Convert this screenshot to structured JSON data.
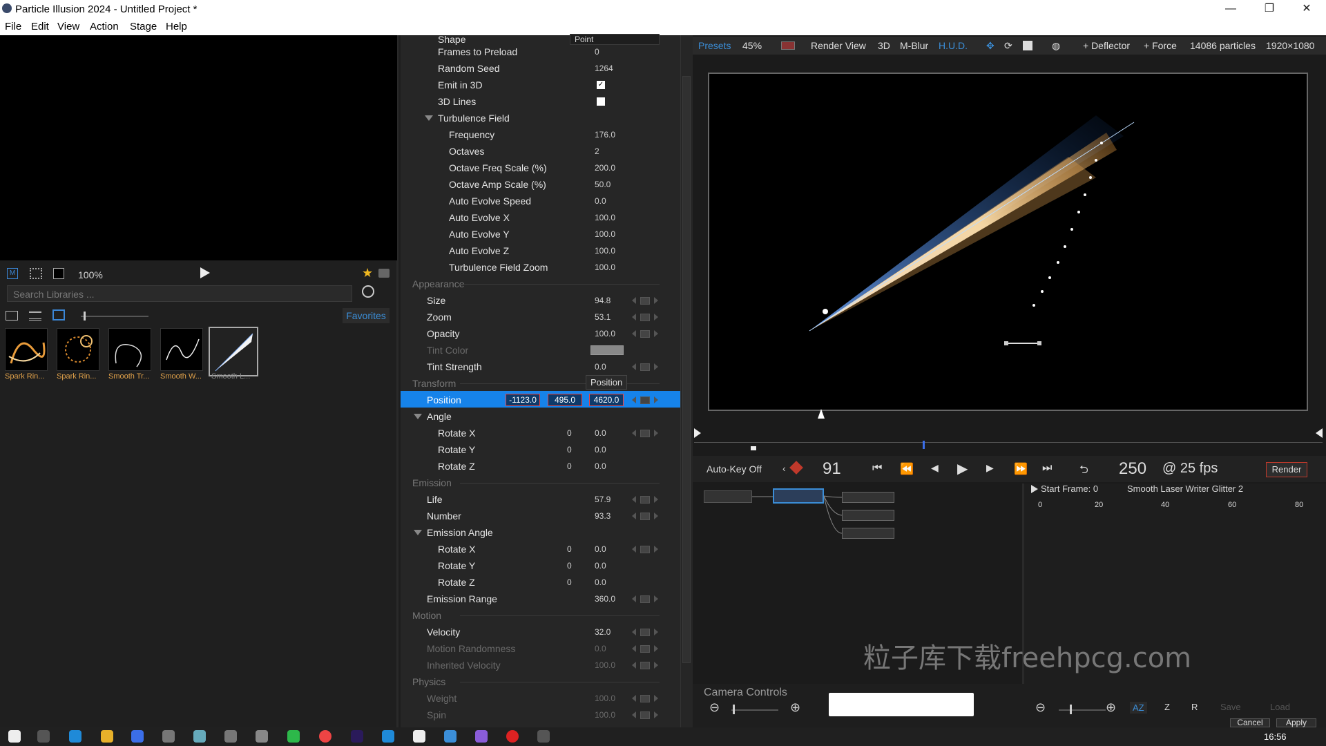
{
  "window": {
    "title": "Particle Illusion 2024 - Untitled Project *",
    "min": "—",
    "max": "❐",
    "close": "✕"
  },
  "menu": [
    "File",
    "Edit",
    "View",
    "Action",
    "Stage",
    "Help"
  ],
  "library": {
    "zoom": "100%",
    "search_placeholder": "Search Libraries ...",
    "favorites": "Favorites",
    "thumbs": [
      "Spark Rin...",
      "Spark Rin...",
      "Smooth Tr...",
      "Smooth W...",
      "Smooth L..."
    ]
  },
  "props": {
    "shape_label": "Shape",
    "shape_value": "Point",
    "rows": [
      {
        "label": "Frames to Preload",
        "value": "0"
      },
      {
        "label": "Random Seed",
        "value": "1264"
      },
      {
        "label": "Emit in 3D",
        "value": "✓"
      },
      {
        "label": "3D Lines",
        "value": ""
      },
      {
        "label": "Turbulence Field",
        "value": ""
      },
      {
        "label": "Frequency",
        "value": "176.0"
      },
      {
        "label": "Octaves",
        "value": "2"
      },
      {
        "label": "Octave Freq Scale (%)",
        "value": "200.0"
      },
      {
        "label": "Octave Amp Scale (%)",
        "value": "50.0"
      },
      {
        "label": "Auto Evolve Speed",
        "value": "0.0"
      },
      {
        "label": "Auto Evolve X",
        "value": "100.0"
      },
      {
        "label": "Auto Evolve Y",
        "value": "100.0"
      },
      {
        "label": "Auto Evolve Z",
        "value": "100.0"
      },
      {
        "label": "Turbulence Field Zoom",
        "value": "100.0"
      },
      {
        "label": "Appearance",
        "value": ""
      },
      {
        "label": "Size",
        "value": "94.8"
      },
      {
        "label": "Zoom",
        "value": "53.1"
      },
      {
        "label": "Opacity",
        "value": "100.0"
      },
      {
        "label": "Tint Color",
        "value": ""
      },
      {
        "label": "Tint Strength",
        "value": "0.0"
      },
      {
        "label": "Transform",
        "value": ""
      },
      {
        "label": "Position",
        "value": ""
      },
      {
        "label": "Angle",
        "value": ""
      },
      {
        "label": "Rotate X",
        "value": "0.0",
        "value2": "0"
      },
      {
        "label": "Rotate Y",
        "value": "0.0",
        "value2": "0"
      },
      {
        "label": "Rotate Z",
        "value": "0.0",
        "value2": "0"
      },
      {
        "label": "Emission",
        "value": ""
      },
      {
        "label": "Life",
        "value": "57.9"
      },
      {
        "label": "Number",
        "value": "93.3"
      },
      {
        "label": "Emission Angle",
        "value": ""
      },
      {
        "label": "Rotate X",
        "value": "0.0",
        "value2": "0"
      },
      {
        "label": "Rotate Y",
        "value": "0.0",
        "value2": "0"
      },
      {
        "label": "Rotate Z",
        "value": "0.0",
        "value2": "0"
      },
      {
        "label": "Emission Range",
        "value": "360.0"
      },
      {
        "label": "Motion",
        "value": ""
      },
      {
        "label": "Velocity",
        "value": "32.0"
      },
      {
        "label": "Motion Randomness",
        "value": "0.0"
      },
      {
        "label": "Inherited Velocity",
        "value": "100.0"
      },
      {
        "label": "Physics",
        "value": ""
      },
      {
        "label": "Weight",
        "value": "100.0"
      },
      {
        "label": "Spin",
        "value": "100.0"
      }
    ],
    "position": {
      "x": "-1123.0",
      "y": "495.0",
      "z": "4620.0",
      "tooltip": "Position"
    }
  },
  "viewer": {
    "presets": "Presets",
    "zoom": "45%",
    "render_view": "Render View",
    "three_d": "3D",
    "mblur": "M-Blur",
    "hud": "H.U.D.",
    "deflector": "+ Deflector",
    "force": "+ Force",
    "particles": "14086 particles",
    "resolution": "1920×1080"
  },
  "transport": {
    "autokey": "Auto-Key Off",
    "frame": "91",
    "total": "250",
    "fps": "@ 25 fps",
    "render": "Render"
  },
  "keys": {
    "start": "Start Frame: 0",
    "name": "Smooth Laser Writer Glitter 2",
    "ticks": [
      "0",
      "20",
      "40",
      "60",
      "80"
    ]
  },
  "bottom": {
    "camera": "Camera Controls",
    "az": "AZ",
    "z": "Z",
    "r": "R",
    "save": "Save",
    "load": "Load",
    "cancel": "Cancel",
    "apply": "Apply"
  },
  "watermark": "粒子库下载freehpcg.com",
  "clock": "16:56",
  "colors": {
    "accent": "#1683ea",
    "orange": "#e0a14a"
  }
}
